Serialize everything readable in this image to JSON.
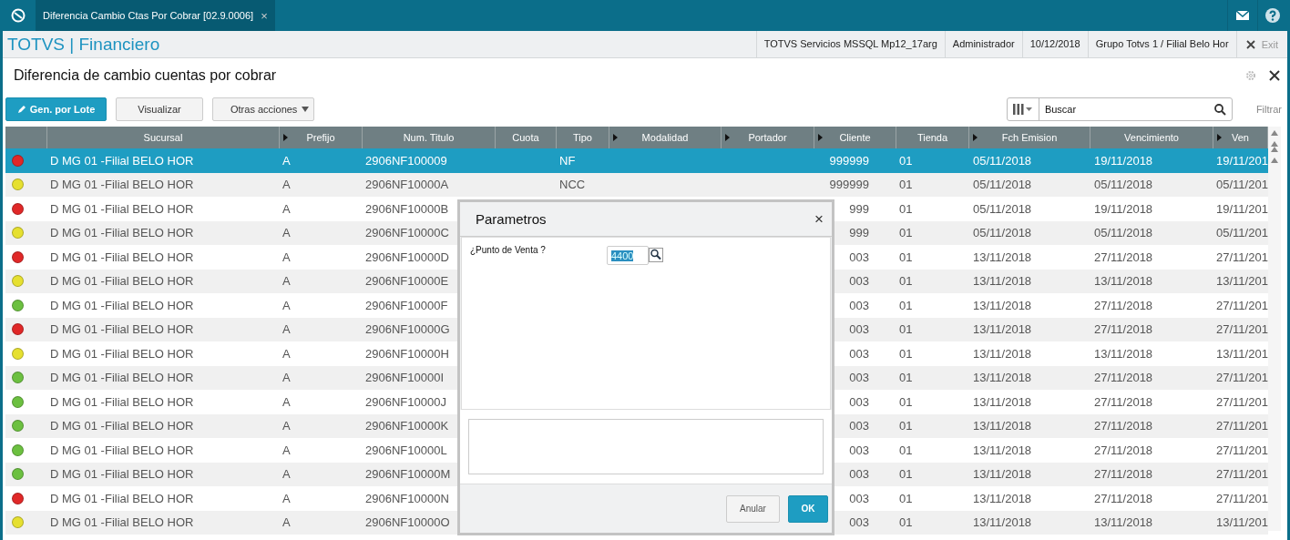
{
  "tab": {
    "label": "Diferencia Cambio Ctas Por Cobrar [02.9.0006]",
    "close": "×"
  },
  "header": {
    "brand": "TOTVS | Financiero",
    "info": [
      "TOTVS Servicios MSSQL Mp12_17arg",
      "Administrador",
      "10/12/2018",
      "Grupo Totvs 1 / Filial Belo Hor"
    ],
    "exit": "Exit"
  },
  "page_title": "Diferencia de cambio cuentas por cobrar",
  "toolbar": {
    "buttons": [
      {
        "label": "Gen. por Lote",
        "kind": "primary"
      },
      {
        "label": "Visualizar",
        "kind": "plain"
      },
      {
        "label": "Otras acciones",
        "kind": "menu"
      }
    ],
    "search": {
      "placeholder": "Buscar"
    },
    "filter": "Filtrar"
  },
  "table": {
    "columns": [
      {
        "label": "Sucursal",
        "marker": false
      },
      {
        "label": "Prefijo",
        "marker": true
      },
      {
        "label": "Num. Titulo",
        "marker": false
      },
      {
        "label": "Cuota",
        "marker": false
      },
      {
        "label": "Tipo",
        "marker": false
      },
      {
        "label": "Modalidad",
        "marker": true
      },
      {
        "label": "Portador",
        "marker": true
      },
      {
        "label": "Cliente",
        "marker": true
      },
      {
        "label": "Tienda",
        "marker": false
      },
      {
        "label": "Fch Emision",
        "marker": true
      },
      {
        "label": "Vencimiento",
        "marker": false
      },
      {
        "label": "Ven",
        "marker": true
      }
    ],
    "rows": [
      {
        "color": "#e02828",
        "selected": true,
        "sucursal": "D MG 01 -Filial BELO HOR",
        "prefijo": "A",
        "titulo": "2906NF100009",
        "tipo": "NF",
        "cliente": "999999",
        "tienda": "01",
        "emision": "05/11/2018",
        "vencimiento": "19/11/2018",
        "column_13": "19/11/201"
      },
      {
        "color": "#e6e030",
        "selected": false,
        "sucursal": "D MG 01 -Filial BELO HOR",
        "prefijo": "A",
        "titulo": "2906NF10000A",
        "tipo": "NCC",
        "cliente": "999999",
        "tienda": "01",
        "emision": "05/11/2018",
        "vencimiento": "05/11/2018",
        "column_13": "05/11/201"
      },
      {
        "color": "#e02828",
        "selected": false,
        "sucursal": "D MG 01 -Filial BELO HOR",
        "prefijo": "A",
        "titulo": "2906NF10000B",
        "cliente": "999",
        "tienda": "01",
        "emision": "05/11/2018",
        "vencimiento": "19/11/2018",
        "column_13": "19/11/201"
      },
      {
        "color": "#e6e030",
        "selected": false,
        "sucursal": "D MG 01 -Filial BELO HOR",
        "prefijo": "A",
        "titulo": "2906NF10000C",
        "cliente": "999",
        "tienda": "01",
        "emision": "05/11/2018",
        "vencimiento": "05/11/2018",
        "column_13": "05/11/201"
      },
      {
        "color": "#e02828",
        "selected": false,
        "sucursal": "D MG 01 -Filial BELO HOR",
        "prefijo": "A",
        "titulo": "2906NF10000D",
        "cliente": "003",
        "tienda": "01",
        "emision": "13/11/2018",
        "vencimiento": "27/11/2018",
        "column_13": "27/11/201"
      },
      {
        "color": "#e6e030",
        "selected": false,
        "sucursal": "D MG 01 -Filial BELO HOR",
        "prefijo": "A",
        "titulo": "2906NF10000E",
        "cliente": "003",
        "tienda": "01",
        "emision": "13/11/2018",
        "vencimiento": "13/11/2018",
        "column_13": "13/11/201"
      },
      {
        "color": "#6cc040",
        "selected": false,
        "sucursal": "D MG 01 -Filial BELO HOR",
        "prefijo": "A",
        "titulo": "2906NF10000F",
        "cliente": "003",
        "tienda": "01",
        "emision": "13/11/2018",
        "vencimiento": "27/11/2018",
        "column_13": "27/11/201"
      },
      {
        "color": "#e02828",
        "selected": false,
        "sucursal": "D MG 01 -Filial BELO HOR",
        "prefijo": "A",
        "titulo": "2906NF10000G",
        "cliente": "003",
        "tienda": "01",
        "emision": "13/11/2018",
        "vencimiento": "27/11/2018",
        "column_13": "27/11/201"
      },
      {
        "color": "#e6e030",
        "selected": false,
        "sucursal": "D MG 01 -Filial BELO HOR",
        "prefijo": "A",
        "titulo": "2906NF10000H",
        "cliente": "003",
        "tienda": "01",
        "emision": "13/11/2018",
        "vencimiento": "13/11/2018",
        "column_13": "13/11/201"
      },
      {
        "color": "#6cc040",
        "selected": false,
        "sucursal": "D MG 01 -Filial BELO HOR",
        "prefijo": "A",
        "titulo": "2906NF10000I",
        "cliente": "003",
        "tienda": "01",
        "emision": "13/11/2018",
        "vencimiento": "27/11/2018",
        "column_13": "27/11/201"
      },
      {
        "color": "#6cc040",
        "selected": false,
        "sucursal": "D MG 01 -Filial BELO HOR",
        "prefijo": "A",
        "titulo": "2906NF10000J",
        "cliente": "003",
        "tienda": "01",
        "emision": "13/11/2018",
        "vencimiento": "27/11/2018",
        "column_13": "27/11/201"
      },
      {
        "color": "#6cc040",
        "selected": false,
        "sucursal": "D MG 01 -Filial BELO HOR",
        "prefijo": "A",
        "titulo": "2906NF10000K",
        "cliente": "003",
        "tienda": "01",
        "emision": "13/11/2018",
        "vencimiento": "27/11/2018",
        "column_13": "27/11/201"
      },
      {
        "color": "#6cc040",
        "selected": false,
        "sucursal": "D MG 01 -Filial BELO HOR",
        "prefijo": "A",
        "titulo": "2906NF10000L",
        "cliente": "003",
        "tienda": "01",
        "emision": "13/11/2018",
        "vencimiento": "27/11/2018",
        "column_13": "27/11/201"
      },
      {
        "color": "#6cc040",
        "selected": false,
        "sucursal": "D MG 01 -Filial BELO HOR",
        "prefijo": "A",
        "titulo": "2906NF10000M",
        "cliente": "003",
        "tienda": "01",
        "emision": "13/11/2018",
        "vencimiento": "27/11/2018",
        "column_13": "27/11/201"
      },
      {
        "color": "#e02828",
        "selected": false,
        "sucursal": "D MG 01 -Filial BELO HOR",
        "prefijo": "A",
        "titulo": "2906NF10000N",
        "cliente": "003",
        "tienda": "01",
        "emision": "13/11/2018",
        "vencimiento": "27/11/2018",
        "column_13": "27/11/201"
      },
      {
        "color": "#e6e030",
        "selected": false,
        "sucursal": "D MG 01 -Filial BELO HOR",
        "prefijo": "A",
        "titulo": "2906NF10000O",
        "cliente": "003",
        "tienda": "01",
        "emision": "13/11/2018",
        "vencimiento": "13/11/2018",
        "column_13": "13/11/201"
      }
    ]
  },
  "dialog": {
    "title": "Parametros",
    "close": "×",
    "question": "¿Punto de Venta ?",
    "value": "4400",
    "buttons": [
      {
        "label": "Anular",
        "kind": "plain"
      },
      {
        "label": "OK",
        "kind": "primary"
      }
    ]
  }
}
